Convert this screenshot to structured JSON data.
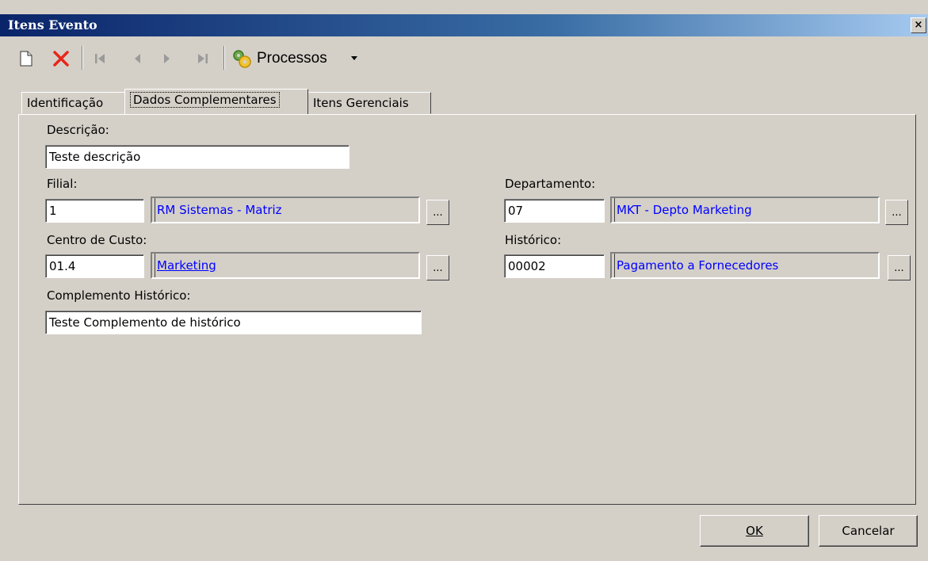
{
  "window": {
    "title": "Itens Evento",
    "close_glyph": "×"
  },
  "toolbar": {
    "new_icon": "new-document-icon",
    "delete_icon": "delete-icon",
    "processos_label": "Processos"
  },
  "tabs": [
    {
      "label": "Identificação"
    },
    {
      "label": "Dados Complementares"
    },
    {
      "label": "Itens Gerenciais"
    }
  ],
  "form": {
    "descricao": {
      "label": "Descrição:",
      "value": "Teste descrição"
    },
    "filial": {
      "label": "Filial:",
      "code": "1",
      "name": "RM Sistemas - Matriz"
    },
    "departamento": {
      "label": "Departamento:",
      "code": "07",
      "name": "MKT - Depto Marketing"
    },
    "centro_custo": {
      "label": "Centro de Custo:",
      "code": "01.4",
      "name": "Marketing"
    },
    "historico": {
      "label": "Histórico:",
      "code": "00002",
      "name": "Pagamento a Fornecedores"
    },
    "complemento": {
      "label": "Complemento Histórico:",
      "value": "Teste Complemento de histórico"
    },
    "lookup_label": "..."
  },
  "buttons": {
    "ok": "OK",
    "cancel": "Cancelar"
  },
  "colors": {
    "link": "#0000ff",
    "title_bar": "#0a246a"
  }
}
